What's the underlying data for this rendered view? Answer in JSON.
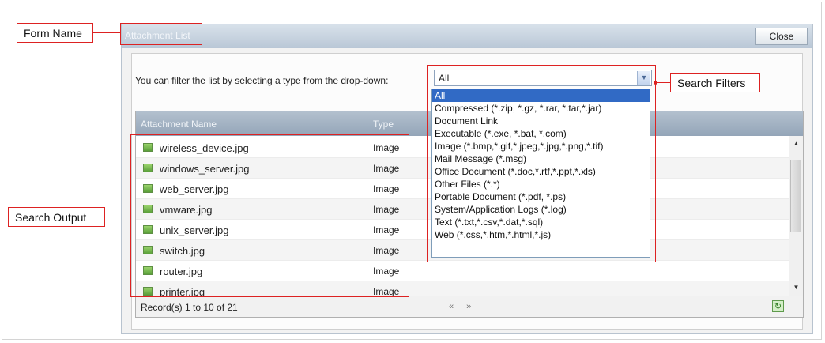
{
  "callouts": {
    "form_name": "Form Name",
    "search_filters": "Search Filters",
    "search_output": "Search Output"
  },
  "dialog": {
    "title": "Attachment List",
    "close_label": "Close"
  },
  "filter": {
    "label": "You can filter the list by selecting a type from the drop-down:",
    "selected": "All",
    "options": [
      "All",
      "Compressed (*.zip, *.gz, *.rar, *.tar,*.jar)",
      "Document Link",
      "Executable (*.exe, *.bat, *.com)",
      "Image (*.bmp,*.gif,*.jpeg,*.jpg,*.png,*.tif)",
      "Mail Message (*.msg)",
      "Office Document (*.doc,*.rtf,*.ppt,*.xls)",
      "Other Files (*.*)",
      "Portable Document (*.pdf, *.ps)",
      "System/Application Logs (*.log)",
      "Text (*.txt,*.csv,*.dat,*.sql)",
      "Web (*.css,*.htm,*.html,*.js)"
    ]
  },
  "grid": {
    "columns": [
      "Attachment Name",
      "Type"
    ],
    "rows": [
      {
        "name": "wireless_device.jpg",
        "type": "Image"
      },
      {
        "name": "windows_server.jpg",
        "type": "Image"
      },
      {
        "name": "web_server.jpg",
        "type": "Image"
      },
      {
        "name": "vmware.jpg",
        "type": "Image"
      },
      {
        "name": "unix_server.jpg",
        "type": "Image"
      },
      {
        "name": "switch.jpg",
        "type": "Image"
      },
      {
        "name": "router.jpg",
        "type": "Image"
      },
      {
        "name": "printer.jpg",
        "type": "Image"
      }
    ],
    "records_text": "Record(s) 1 to 10 of 21",
    "pager_prev": "«",
    "pager_next": "»"
  },
  "icons": {
    "file": "image-file-icon",
    "refresh": "refresh-icon",
    "dropdown": "chevron-down-icon"
  },
  "colors": {
    "callout_border": "#dd2222",
    "selected_option": "#316ac5",
    "header_gradient": "#94a5b8"
  }
}
